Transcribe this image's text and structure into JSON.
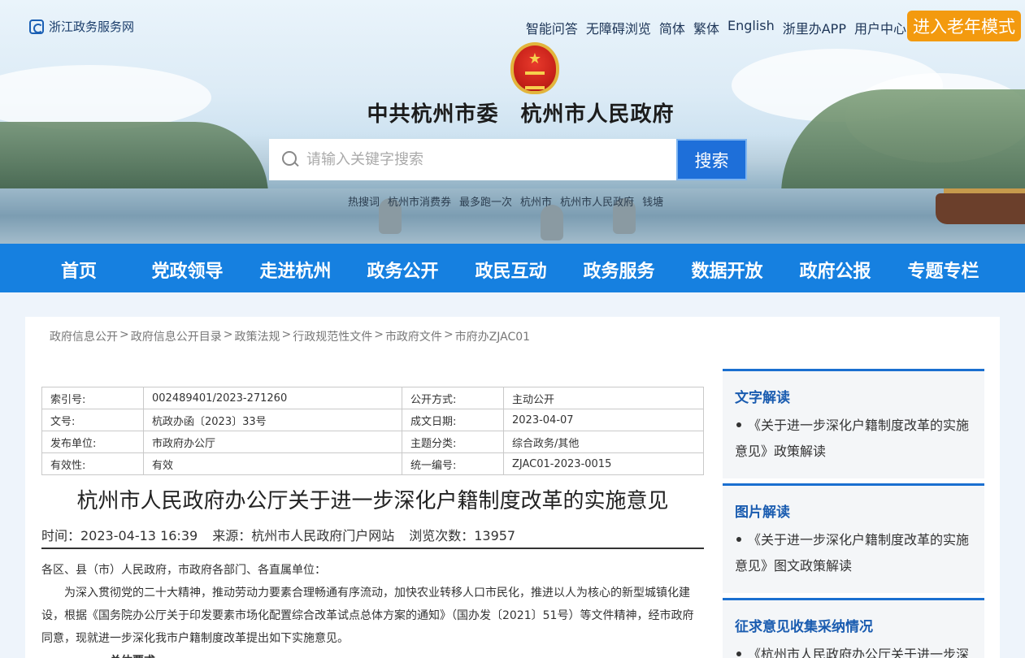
{
  "header": {
    "site_name": "浙江政务服务网",
    "top_links": [
      "智能问答",
      "无障碍浏览",
      "简体",
      "繁体",
      "English",
      "浙里办APP",
      "用户中心"
    ],
    "elder_mode_label": "进入老年模式",
    "gov_title": "中共杭州市委　杭州市人民政府",
    "search_placeholder": "请输入关键字搜索",
    "search_button": "搜索",
    "hot_words": [
      "热搜词",
      "杭州市消费券",
      "最多跑一次",
      "杭州市",
      "杭州市人民政府",
      "钱塘"
    ]
  },
  "nav": {
    "items": [
      "首页",
      "党政领导",
      "走进杭州",
      "政务公开",
      "政民互动",
      "政务服务",
      "数据开放",
      "政府公报",
      "专题专栏"
    ]
  },
  "breadcrumb": [
    "政府信息公开",
    "政府信息公开目录",
    "政策法规",
    "行政规范性文件",
    "市政府文件",
    "市府办ZJAC01"
  ],
  "meta_table": [
    {
      "k1": "索引号:",
      "v1": "002489401/2023-271260",
      "k2": "公开方式:",
      "v2": "主动公开"
    },
    {
      "k1": "文号:",
      "v1": "杭政办函〔2023〕33号",
      "k2": "成文日期:",
      "v2": "2023-04-07"
    },
    {
      "k1": "发布单位:",
      "v1": "市政府办公厅",
      "k2": "主题分类:",
      "v2": "综合政务/其他"
    },
    {
      "k1": "有效性:",
      "v1": "有效",
      "k2": "统一编号:",
      "v2": "ZJAC01-2023-0015"
    }
  ],
  "article": {
    "title": "杭州市人民政府办公厅关于进一步深化户籍制度改革的实施意见",
    "time": "时间：2023-04-13 16:39",
    "source": "来源：杭州市人民政府门户网站",
    "views": "浏览次数：13957",
    "salutation": "各区、县（市）人民政府，市政府各部门、各直属单位：",
    "paragraph1": "为深入贯彻党的二十大精神，推动劳动力要素合理畅通有序流动，加快农业转移人口市民化，推进以人为核心的新型城镇化建设，根据《国务院办公厅关于印发要素市场化配置综合改革试点总体方案的通知》（国办发〔2021〕51号）等文件精神，经市政府同意，现就进一步深化我市户籍制度改革提出如下实施意见。",
    "section1": "一、总体要求"
  },
  "sidebar": [
    {
      "title": "文字解读",
      "item": "《关于进一步深化户籍制度改革的实施意见》政策解读"
    },
    {
      "title": "图片解读",
      "item": "《关于进一步深化户籍制度改革的实施意见》图文政策解读"
    },
    {
      "title": "征求意见收集采纳情况",
      "item": "《杭州市人民政府办公厅关于进一步深"
    }
  ]
}
